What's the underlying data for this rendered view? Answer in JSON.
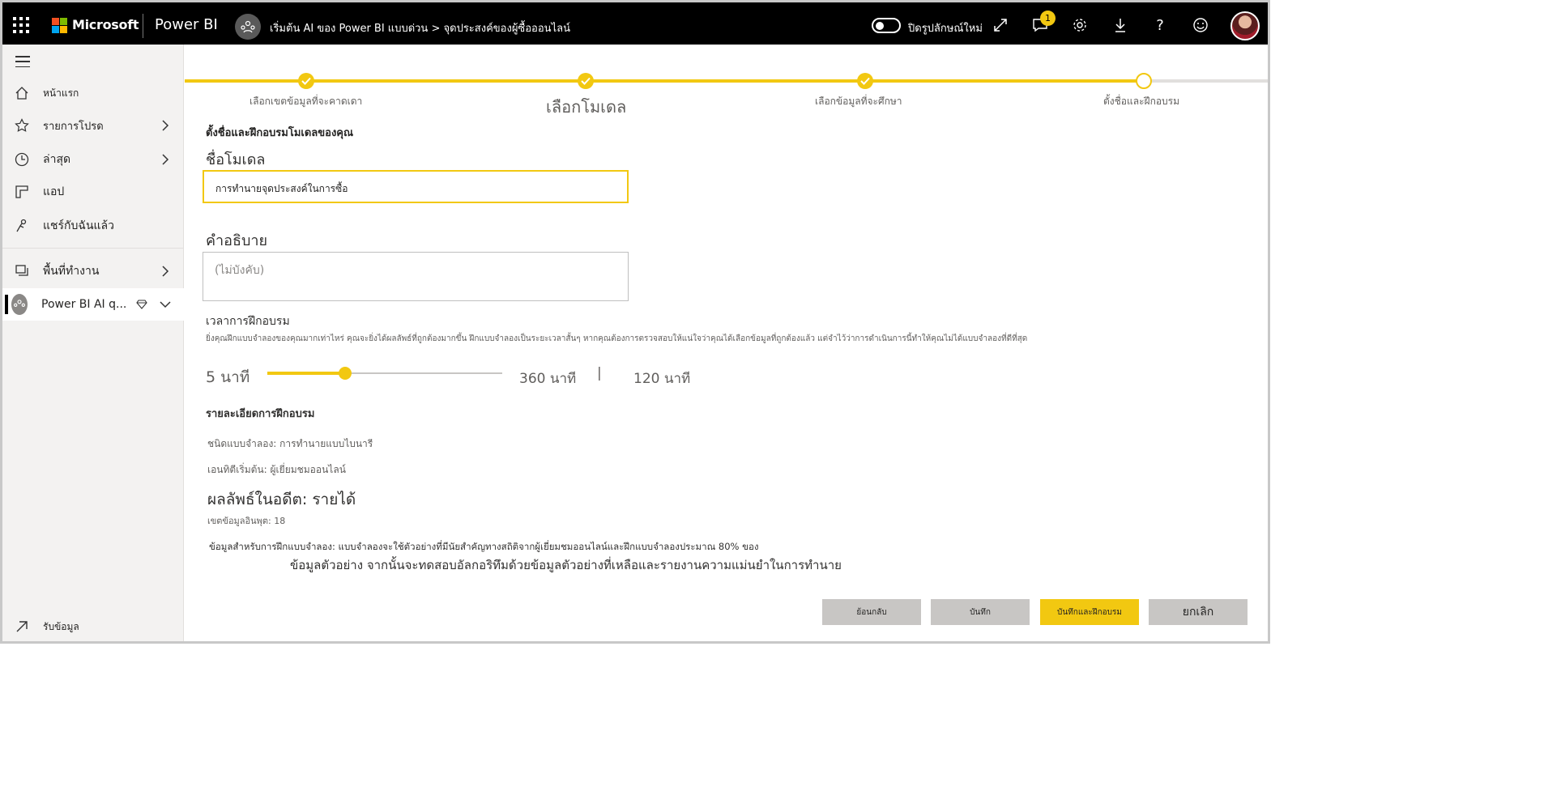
{
  "topbar": {
    "ms_label": "Microsoft",
    "app_name": "Power BI",
    "breadcrumb": "เริ่มต้น AI ของ Power BI แบบด่วน",
    "breadcrumb_sep": ">",
    "breadcrumb_current": "จุดประสงค์ของผู้ซื้อออนไลน์",
    "toggle_label": "ปิดรูปลักษณ์ใหม่",
    "notification_count": "1",
    "icons": [
      "expand-icon",
      "notification-icon",
      "settings-icon",
      "download-icon",
      "help-icon",
      "feedback-icon"
    ]
  },
  "sidebar": {
    "items": [
      {
        "label": "หน้าแรก",
        "icon": "home-icon"
      },
      {
        "label": "รายการโปรด",
        "icon": "star-icon"
      },
      {
        "label": "ล่าสุด",
        "icon": "clock-icon"
      },
      {
        "label": "แอป",
        "icon": "apps-icon"
      },
      {
        "label": "แชร์กับฉันแล้ว",
        "icon": "shared-icon"
      },
      {
        "label": "พื้นที่ทำงาน",
        "icon": "workspaces-icon"
      }
    ],
    "current_workspace": "Power BI AI q...",
    "get_data": "รับข้อมูล"
  },
  "stepper": {
    "steps": [
      {
        "label": "เลือกเขตข้อมูลที่จะคาดเดา",
        "state": "done"
      },
      {
        "label": "เลือกโมเดล",
        "state": "done"
      },
      {
        "label": "เลือกข้อมูลที่จะศึกษา",
        "state": "done"
      },
      {
        "label": "ตั้งชื่อและฝึกอบรม",
        "state": "current"
      }
    ],
    "progress_color": "#F2C811"
  },
  "form": {
    "section_title": "ตั้งชื่อและฝึกอบรมโมเดลของคุณ",
    "model_name_label": "ชื่อโมเดล",
    "model_name_value": "การทำนายจุดประสงค์ในการซื้อ",
    "description_label": "คำอธิบาย",
    "description_placeholder": "(ไม่บังคับ)",
    "training_time_label": "เวลาการฝึกอบรม",
    "training_time_help": "ยิ่งคุณฝึกแบบจำลองของคุณมากเท่าไหร่ คุณจะยิ่งได้ผลลัพธ์ที่ถูกต้องมากขึ้น ฝึกแบบจำลองเป็นระยะเวลาสั้นๆ หากคุณต้องการตรวจสอบให้แน่ใจว่าคุณได้เลือกข้อมูลที่ถูกต้องแล้ว แต่จำไว้ว่าการดำเนินการนี้ทำให้คุณไม่ได้แบบจำลองที่ดีที่สุด",
    "slider_min": "5 นาที",
    "slider_max": "360 นาที",
    "slider_separator": "|",
    "slider_value": "120 นาที",
    "slider_fraction": 0.33
  },
  "details": {
    "title": "รายละเอียดการฝึกอบรม",
    "model_type": "ชนิดแบบจำลอง: การทำนายแบบไบนารี",
    "entity": "เอนทิตีเริ่มต้น: ผู้เยี่ยมชมออนไลน์",
    "outcome": "ผลลัพธ์ในอดีต: รายได้",
    "input_fields": "เขตข้อมูลอินพุต: 18",
    "training_data_line1": "ข้อมูลสำหรับการฝึกแบบจำลอง: แบบจำลองจะใช้ตัวอย่างที่มีนัยสำคัญทางสถิติจากผู้เยี่ยมชมออนไลน์และฝึกแบบจำลองประมาณ 80% ของ",
    "training_data_line2": "ข้อมูลตัวอย่าง จากนั้นจะทดสอบอัลกอริทึมด้วยข้อมูลตัวอย่างที่เหลือและรายงานความแม่นยำในการทำนาย"
  },
  "buttons": {
    "back": "ย้อนกลับ",
    "save": "บันทึก",
    "save_train": "บันทึกและฝึกอบรม",
    "cancel": "ยกเลิก"
  }
}
